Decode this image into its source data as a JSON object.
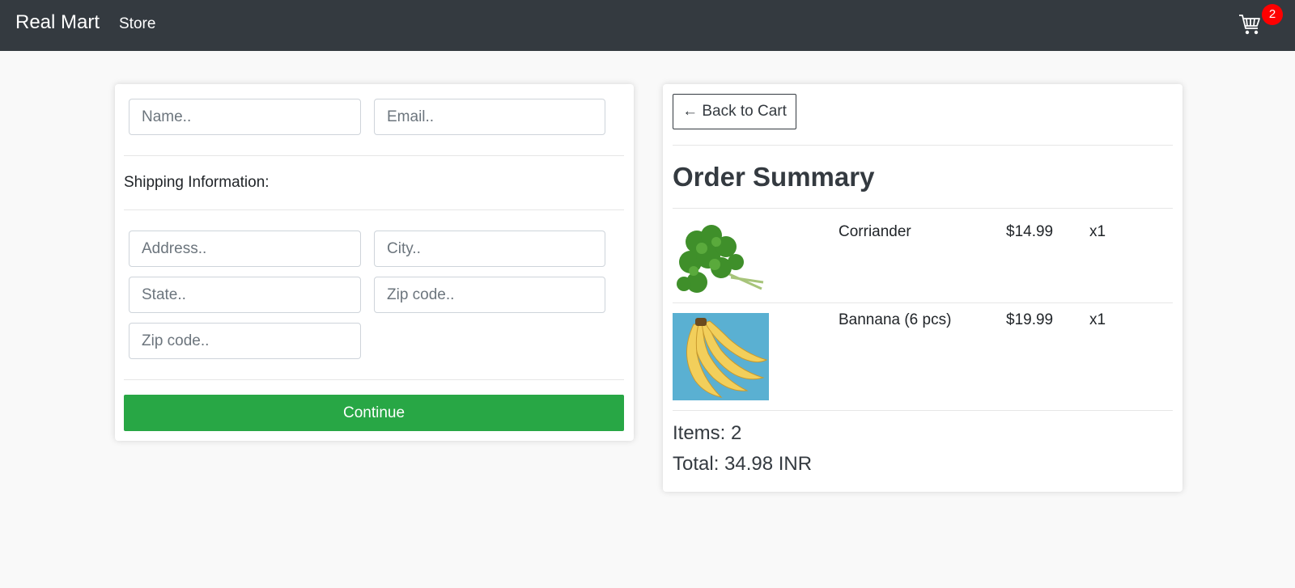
{
  "navbar": {
    "brand": "Real Mart",
    "store_link": "Store",
    "cart_count": "2"
  },
  "form": {
    "name_placeholder": "Name..",
    "email_placeholder": "Email..",
    "shipping_label": "Shipping Information:",
    "address_placeholder": "Address..",
    "city_placeholder": "City..",
    "state_placeholder": "State..",
    "zip_placeholder": "Zip code..",
    "zip2_placeholder": "Zip code..",
    "continue_label": "Continue"
  },
  "summary": {
    "back_label": "← Back to Cart",
    "title": "Order Summary",
    "items": [
      {
        "name": "Corriander",
        "price": "$14.99",
        "qty": "x1"
      },
      {
        "name": "Bannana (6 pcs)",
        "price": "$19.99",
        "qty": "x1"
      }
    ],
    "items_count": "Items: 2",
    "total": "Total: 34.98 INR"
  },
  "colors": {
    "navbar": "#343a40",
    "continue": "#28a745",
    "badge": "#ff0000"
  },
  "icons": [
    "cart-icon",
    "coriander-image",
    "banana-image"
  ]
}
